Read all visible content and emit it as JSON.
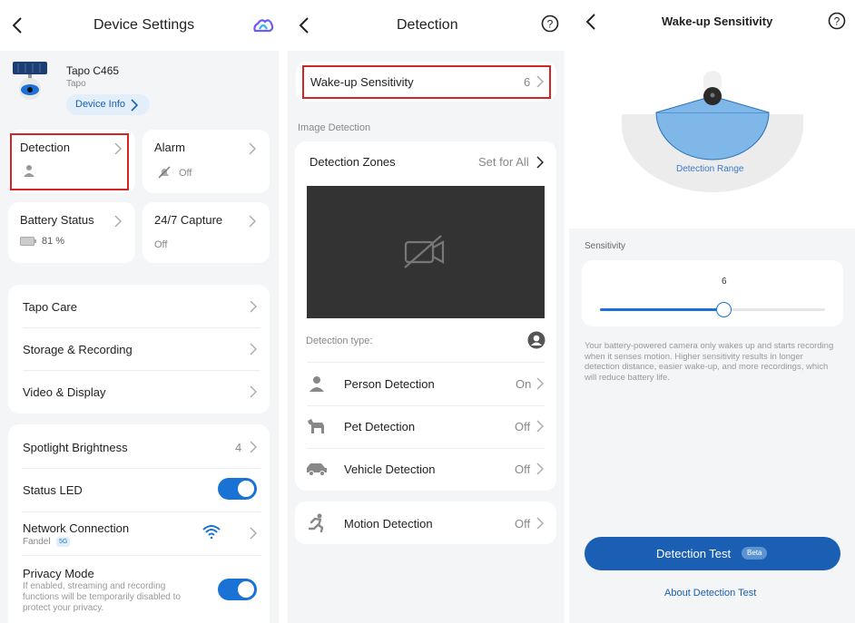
{
  "device_settings": {
    "title": "Device Settings",
    "device_name": "Tapo C465",
    "brand": "Tapo",
    "device_info_label": "Device Info",
    "tiles": {
      "detection": "Detection",
      "alarm": "Alarm",
      "alarm_value": "Off",
      "battery": "Battery Status",
      "battery_value": "81 %",
      "capture": "24/7 Capture",
      "capture_value": "Off"
    },
    "menu_group1": [
      "Tapo Care",
      "Storage & Recording",
      "Video & Display"
    ],
    "spotlight_label": "Spotlight Brightness",
    "spotlight_value": "4",
    "status_led_label": "Status LED",
    "network_label": "Network Connection",
    "network_ssid": "Fandel",
    "network_band": "5G",
    "privacy_label": "Privacy Mode",
    "privacy_desc": "If enabled, streaming and recording functions will be temporarily disabled to protect your privacy."
  },
  "detection": {
    "title": "Detection",
    "wakeup_label": "Wake-up Sensitivity",
    "wakeup_value": "6",
    "image_detection_section": "Image Detection",
    "zones_label": "Detection Zones",
    "zones_value": "Set for All",
    "detection_type_label": "Detection type:",
    "items": [
      {
        "label": "Person Detection",
        "value": "On"
      },
      {
        "label": "Pet Detection",
        "value": "Off"
      },
      {
        "label": "Vehicle Detection",
        "value": "Off"
      }
    ],
    "motion_label": "Motion Detection",
    "motion_value": "Off"
  },
  "wakeup": {
    "title": "Wake-up Sensitivity",
    "range_label": "Detection Range",
    "sensitivity_section": "Sensitivity",
    "slider_value": "6",
    "slider_fraction": 0.55,
    "description": "Your battery-powered camera only wakes up and starts recording when it senses motion. Higher sensitivity results in longer detection distance, easier wake-up, and more recordings, which will reduce battery life.",
    "test_button": "Detection Test",
    "test_badge": "Beta",
    "about_link": "About Detection Test"
  },
  "colors": {
    "accent": "#1a73d4",
    "highlight": "#d32525",
    "range_fill": "#7fb8e8"
  }
}
